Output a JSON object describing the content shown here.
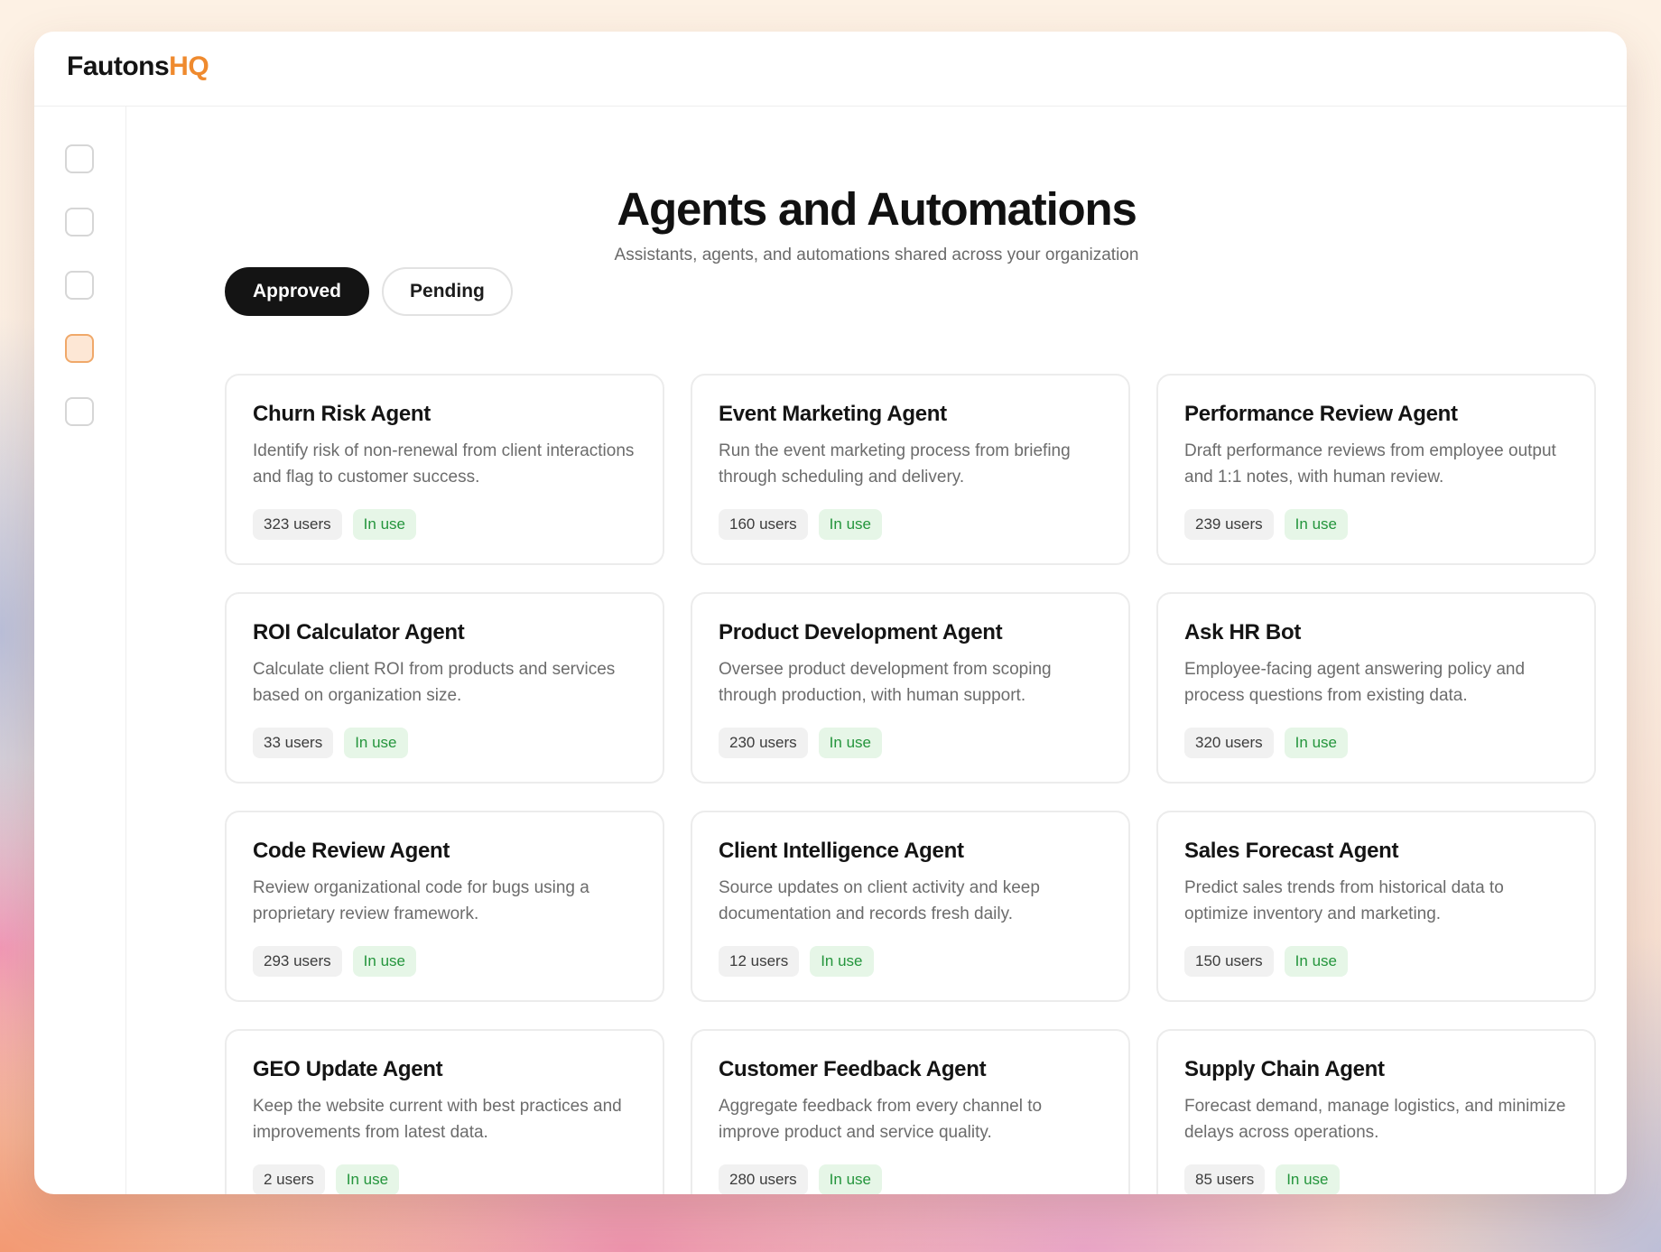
{
  "app": {
    "brand_name": "Fautons",
    "brand_accent": "HQ",
    "accent_color": "#ef8a2e"
  },
  "sidebar": {
    "items": [
      {
        "icon": "square-outline-icon",
        "active": false
      },
      {
        "icon": "square-outline-icon",
        "active": false
      },
      {
        "icon": "square-outline-icon",
        "active": false
      },
      {
        "icon": "square-outline-icon",
        "active": true
      },
      {
        "icon": "square-outline-icon",
        "active": false
      }
    ]
  },
  "header": {
    "title": "Agents and Automations",
    "subtitle": "Assistants, agents, and automations shared across your organization"
  },
  "tabs": [
    {
      "label": "Approved",
      "active": true
    },
    {
      "label": "Pending",
      "active": false
    }
  ],
  "cards": [
    {
      "title": "Churn Risk Agent",
      "description": "Identify risk of non-renewal from client interactions and flag to customer success.",
      "users": "323 users",
      "status": "In use"
    },
    {
      "title": "Event Marketing Agent",
      "description": "Run the event marketing process from briefing through scheduling and delivery.",
      "users": "160 users",
      "status": "In use"
    },
    {
      "title": "Performance Review Agent",
      "description": "Draft performance reviews from employee output and 1:1 notes, with human review.",
      "users": "239 users",
      "status": "In use"
    },
    {
      "title": "ROI Calculator Agent",
      "description": "Calculate client ROI from products and services based on organization size.",
      "users": "33 users",
      "status": "In use"
    },
    {
      "title": "Product Development Agent",
      "description": "Oversee product development from scoping through production, with human support.",
      "users": "230 users",
      "status": "In use"
    },
    {
      "title": "Ask HR Bot",
      "description": "Employee-facing agent answering policy and process questions from existing data.",
      "users": "320 users",
      "status": "In use"
    },
    {
      "title": "Code Review Agent",
      "description": "Review organizational code for bugs using a proprietary review framework.",
      "users": "293 users",
      "status": "In use"
    },
    {
      "title": "Client Intelligence Agent",
      "description": "Source updates on client activity and keep documentation and records fresh daily.",
      "users": "12 users",
      "status": "In use"
    },
    {
      "title": "Sales Forecast Agent",
      "description": "Predict sales trends from historical data to optimize inventory and marketing.",
      "users": "150 users",
      "status": "In use"
    },
    {
      "title": "GEO Update Agent",
      "description": "Keep the website current with best practices and improvements from latest data.",
      "users": "2 users",
      "status": "In use"
    },
    {
      "title": "Customer Feedback Agent",
      "description": "Aggregate feedback from every channel to improve product and service quality.",
      "users": "280 users",
      "status": "In use"
    },
    {
      "title": "Supply Chain Agent",
      "description": "Forecast demand, manage logistics, and minimize delays across operations.",
      "users": "85 users",
      "status": "In use"
    }
  ]
}
